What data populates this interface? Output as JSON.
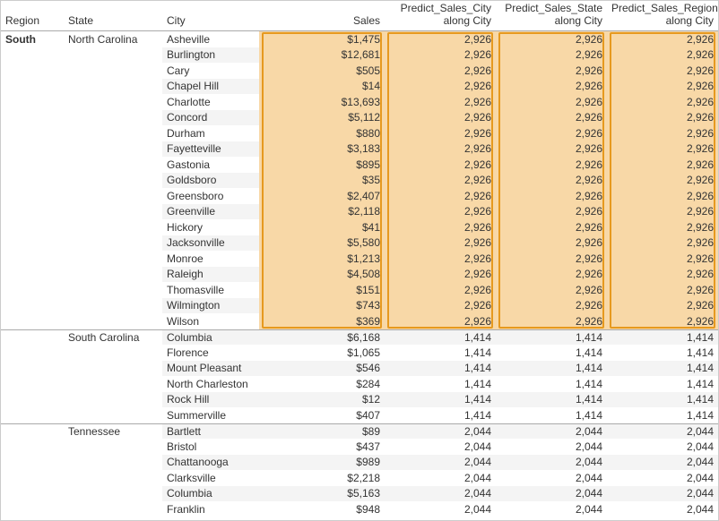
{
  "columns": {
    "region": "Region",
    "state": "State",
    "city": "City",
    "sales": "Sales",
    "pred_city_line1": "Predict_Sales_City",
    "pred_city_line2": "along City",
    "pred_state_line1": "Predict_Sales_State",
    "pred_state_line2": "along City",
    "pred_region_line1": "Predict_Sales_Region",
    "pred_region_line2": "along City"
  },
  "region": "South",
  "states": [
    {
      "name": "North Carolina",
      "highlighted": true,
      "predict": "2,926",
      "cities": [
        {
          "name": "Asheville",
          "sales": "$1,475"
        },
        {
          "name": "Burlington",
          "sales": "$12,681"
        },
        {
          "name": "Cary",
          "sales": "$505"
        },
        {
          "name": "Chapel Hill",
          "sales": "$14"
        },
        {
          "name": "Charlotte",
          "sales": "$13,693"
        },
        {
          "name": "Concord",
          "sales": "$5,112"
        },
        {
          "name": "Durham",
          "sales": "$880"
        },
        {
          "name": "Fayetteville",
          "sales": "$3,183"
        },
        {
          "name": "Gastonia",
          "sales": "$895"
        },
        {
          "name": "Goldsboro",
          "sales": "$35"
        },
        {
          "name": "Greensboro",
          "sales": "$2,407"
        },
        {
          "name": "Greenville",
          "sales": "$2,118"
        },
        {
          "name": "Hickory",
          "sales": "$41"
        },
        {
          "name": "Jacksonville",
          "sales": "$5,580"
        },
        {
          "name": "Monroe",
          "sales": "$1,213"
        },
        {
          "name": "Raleigh",
          "sales": "$4,508"
        },
        {
          "name": "Thomasville",
          "sales": "$151"
        },
        {
          "name": "Wilmington",
          "sales": "$743"
        },
        {
          "name": "Wilson",
          "sales": "$369"
        }
      ]
    },
    {
      "name": "South Carolina",
      "highlighted": false,
      "predict": "1,414",
      "cities": [
        {
          "name": "Columbia",
          "sales": "$6,168"
        },
        {
          "name": "Florence",
          "sales": "$1,065"
        },
        {
          "name": "Mount Pleasant",
          "sales": "$546"
        },
        {
          "name": "North Charleston",
          "sales": "$284"
        },
        {
          "name": "Rock Hill",
          "sales": "$12"
        },
        {
          "name": "Summerville",
          "sales": "$407"
        }
      ]
    },
    {
      "name": "Tennessee",
      "highlighted": false,
      "predict": "2,044",
      "cities": [
        {
          "name": "Bartlett",
          "sales": "$89"
        },
        {
          "name": "Bristol",
          "sales": "$437"
        },
        {
          "name": "Chattanooga",
          "sales": "$989"
        },
        {
          "name": "Clarksville",
          "sales": "$2,218"
        },
        {
          "name": "Columbia",
          "sales": "$5,163"
        },
        {
          "name": "Franklin",
          "sales": "$948"
        }
      ]
    }
  ]
}
